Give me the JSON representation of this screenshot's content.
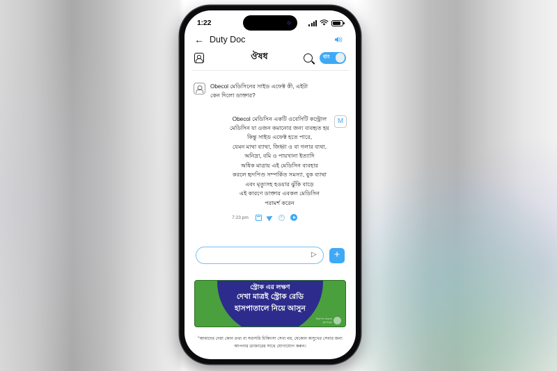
{
  "status_bar": {
    "time": "1:22",
    "signal_icon": "cellular-bars-icon",
    "wifi_icon": "wifi-icon",
    "battery_icon": "battery-icon"
  },
  "app_bar": {
    "back_icon": "back-arrow-icon",
    "title": "Duty Doc",
    "speaker_icon": "speaker-icon"
  },
  "tabs_row": {
    "profile_icon": "person-icon",
    "tab_label": "ঔষধ",
    "search_icon": "search-icon",
    "language_toggle_label": "বাং",
    "language_toggle_on": true
  },
  "chat": {
    "user_message": {
      "avatar_icon": "person-avatar-icon",
      "text": "Obecol মেডিসিনের সাইড এফেক্ট কী, এইটা কেন দিলো ডাক্তার?"
    },
    "bot_message": {
      "avatar_label": "M",
      "lines": [
        "Obecol মেডিসিন একটি ওবেসিটি কন্ট্রোল",
        "মেডিসিন যা ওজন কমানোর জন্য ব্যবহৃত হয়",
        "কিন্তু সাইড এফেক্ট হতে পারে,",
        "যেমন মাথা ব্যাথা, জিহ্বা ও বা গলার ব্যথা,",
        "অনিদ্রা, বমি ও পায়খানা ইত্যাদি",
        "অধিক মাত্রায় এই মেডিসিন ব্যবহার",
        "করলে হৃদপিণ্ড সম্পর্কিত সমস্যা, বুক ব্যাথা",
        "এবং মৃত্যুসহ হওয়ার ঝুঁকি বাড়ে",
        "এই কারণে ডাক্তার এবকল মেডিসিন",
        "পরামর্শ করেন"
      ],
      "timestamp": "7:23 pm",
      "action_icons": [
        "copy-icon",
        "share-icon",
        "stop-icon",
        "play-icon"
      ]
    }
  },
  "composer": {
    "input_value": "",
    "input_placeholder": "",
    "send_icon": "send-arrow-icon",
    "add_button_label": "+"
  },
  "banner": {
    "line1": "স্ট্রোক এর লক্ষণ",
    "line2": "দেখা মাত্রই স্ট্রোক রেডি",
    "line3": "হাসপাতালে নিয়ে আসুন",
    "logo_line1": "নিরাপদে থাকতে",
    "logo_line2": "সুস্থ থাকুন",
    "bg_color": "#4aa03c",
    "dome_color": "#2d2c8c"
  },
  "disclaimer": {
    "text": "\"আমাদের দেয়া কোন তথ্য বা সরাসরি চিকিৎসা সেবা নয়, যেকোন অসুখের সেবার জন্য আপনার ডাক্তারের সাথে যোগাযোগ করুন।"
  },
  "colors": {
    "accent": "#3fa9f5",
    "text": "#1b1b1b"
  }
}
